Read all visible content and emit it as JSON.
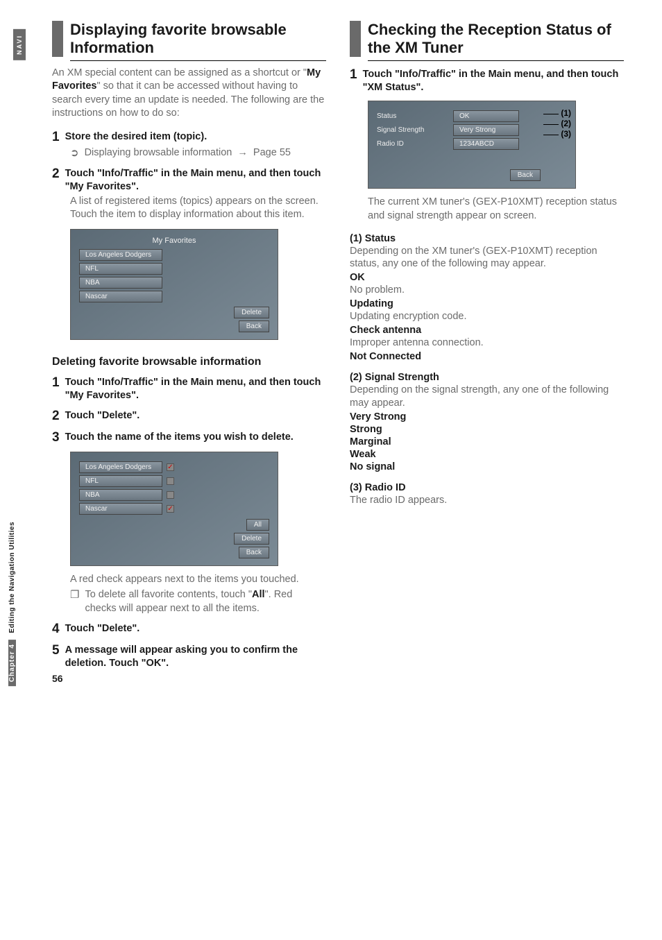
{
  "sideTab": {
    "navi": "NAVI",
    "chapter": "Chapter 4",
    "util": "Editing the Navigation Utilities"
  },
  "left": {
    "title": "Displaying favorite browsable Information",
    "intro_a": "An XM special content can be assigned as a shortcut or \"",
    "intro_bold": "My Favorites",
    "intro_b": "\" so that it can be accessed without having to search every time an update is needed. The following are the instructions on how to do so:",
    "s1": {
      "n": "1",
      "txt": "Store the desired item (topic).",
      "bullet_sym": "➲",
      "bullet_txt_a": "Displaying browsable information",
      "arrow": "→",
      "bullet_txt_b": "Page 55"
    },
    "s2": {
      "n": "2",
      "txt": "Touch \"Info/Traffic\" in the Main menu, and then touch \"My Favorites\".",
      "body": "A list of registered items (topics) appears on the screen. Touch the item to display information about this item."
    },
    "fig1": {
      "title": "My Favorites",
      "items": [
        "Los Angeles Dodgers",
        "NFL",
        "NBA",
        "Nascar"
      ],
      "delete": "Delete",
      "back": "Back"
    },
    "subheading": "Deleting favorite browsable information",
    "d1": {
      "n": "1",
      "txt": "Touch \"Info/Traffic\" in the Main menu, and then touch \"My Favorites\"."
    },
    "d2": {
      "n": "2",
      "txt": "Touch \"Delete\"."
    },
    "d3": {
      "n": "3",
      "txt": "Touch the name of the items you wish to delete."
    },
    "fig2": {
      "items": [
        {
          "label": "Los Angeles Dodgers",
          "checked": true
        },
        {
          "label": "NFL",
          "checked": false
        },
        {
          "label": "NBA",
          "checked": false
        },
        {
          "label": "Nascar",
          "checked": true
        }
      ],
      "all": "All",
      "delete": "Delete",
      "back": "Back"
    },
    "d3_body": "A red check appears next to the items you touched.",
    "d3_note_sym": "❐",
    "d3_note_a": "To delete all favorite contents, touch \"",
    "d3_note_bold": "All",
    "d3_note_b": "\". Red checks will appear next to all the items.",
    "d4": {
      "n": "4",
      "txt": "Touch \"Delete\"."
    },
    "d5": {
      "n": "5",
      "txt": "A message will appear asking you to confirm the deletion. Touch \"OK\"."
    }
  },
  "right": {
    "title": "Checking the Reception Status of the XM Tuner",
    "s1": {
      "n": "1",
      "txt": "Touch \"Info/Traffic\" in the Main menu, and then touch \"XM Status\"."
    },
    "fig": {
      "rows": [
        {
          "label": "Status",
          "value": "OK",
          "call": "(1)"
        },
        {
          "label": "Signal Strength",
          "value": "Very Strong",
          "call": "(2)"
        },
        {
          "label": "Radio ID",
          "value": "1234ABCD",
          "call": "(3)"
        }
      ],
      "back": "Back"
    },
    "s1_body": "The current XM tuner's (GEX-P10XMT) reception status and signal strength appear on screen.",
    "p1_t": "(1) Status",
    "p1_b": "Depending on the XM tuner's (GEX-P10XMT) reception status, any one of the following may appear.",
    "ok_t": "OK",
    "ok_b": "No problem.",
    "up_t": "Updating",
    "up_b": "Updating encryption code.",
    "ca_t": "Check antenna",
    "ca_b": "Improper antenna connection.",
    "nc_t": "Not Connected",
    "p2_t": "(2) Signal Strength",
    "p2_b": "Depending on the signal strength, any one of the following may appear.",
    "ss": [
      "Very Strong",
      "Strong",
      "Marginal",
      "Weak",
      "No signal"
    ],
    "p3_t": "(3) Radio ID",
    "p3_b": "The radio ID appears."
  },
  "pageNumber": "56"
}
